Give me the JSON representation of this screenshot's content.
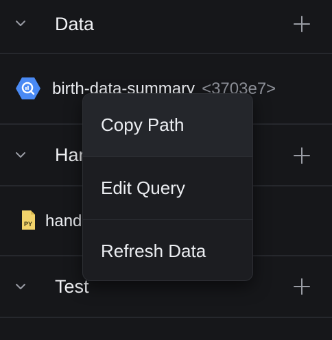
{
  "sections": {
    "data": {
      "title": "Data"
    },
    "handlers": {
      "title": "Handlers"
    },
    "test": {
      "title": "Test"
    }
  },
  "items": {
    "bigquery": {
      "name": "birth-data-summary",
      "hash": "<3703e7>",
      "icon": "bigquery-icon",
      "icon_color": "#4a8af4"
    },
    "python": {
      "name": "handler",
      "icon": "python-file-icon",
      "icon_color": "#f2d36b",
      "icon_text": "PY"
    }
  },
  "context_menu": {
    "items": [
      {
        "label": "Copy Path"
      },
      {
        "label": "Edit Query"
      },
      {
        "label": "Refresh Data"
      }
    ]
  },
  "colors": {
    "background": "#16171a",
    "divider": "#26282d",
    "menu_background": "#1c1d21",
    "menu_hover": "#24262b",
    "muted_text": "#8e9199"
  }
}
